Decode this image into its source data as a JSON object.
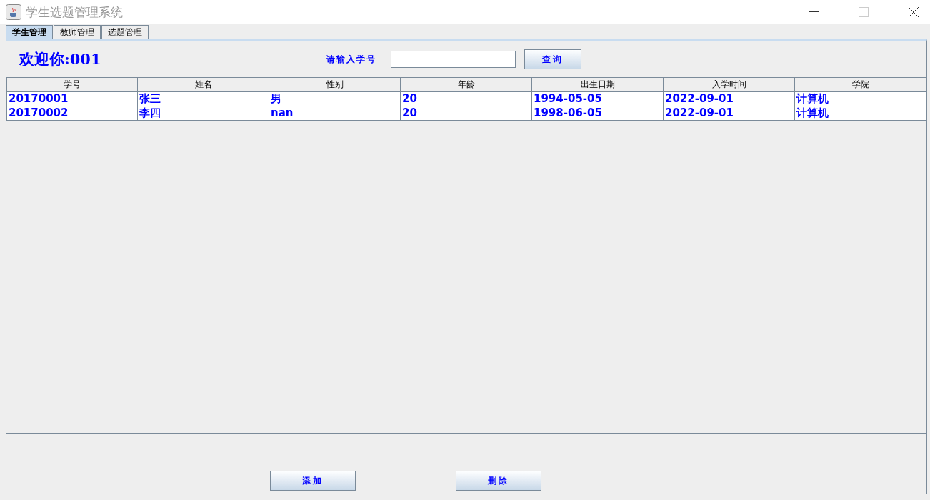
{
  "window": {
    "title": "学生选题管理系统"
  },
  "tabs": [
    {
      "label": "学生管理",
      "selected": true
    },
    {
      "label": "教师管理",
      "selected": false
    },
    {
      "label": "选题管理",
      "selected": false
    }
  ],
  "welcome": "欢迎你:001",
  "search": {
    "label": "请输入学号",
    "button": "查询"
  },
  "table": {
    "columns": [
      "学号",
      "姓名",
      "性别",
      "年龄",
      "出生日期",
      "入学时间",
      "学院"
    ],
    "rows": [
      [
        "20170001",
        "张三",
        "男",
        "20",
        "1994-05-05",
        "2022-09-01",
        "计算机"
      ],
      [
        "20170002",
        "李四",
        "nan",
        "20",
        "1998-06-05",
        "2022-09-01",
        "计算机"
      ]
    ]
  },
  "buttons": [
    "添加",
    "删除"
  ]
}
